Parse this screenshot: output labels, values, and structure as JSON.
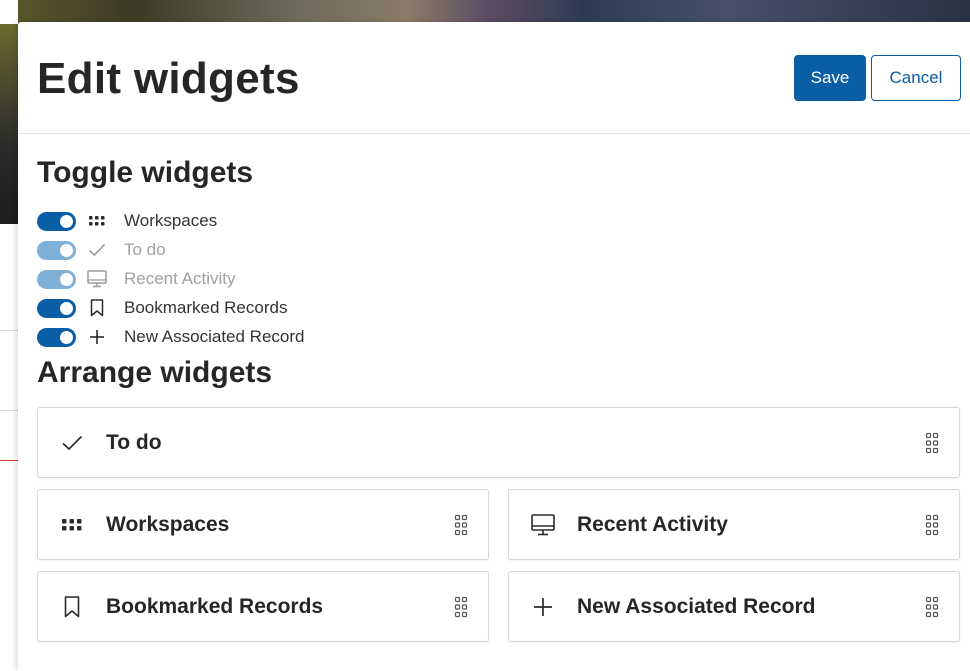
{
  "modal": {
    "title": "Edit widgets",
    "save_label": "Save",
    "cancel_label": "Cancel"
  },
  "toggle_section": {
    "title": "Toggle widgets",
    "items": [
      {
        "label": "Workspaces",
        "icon": "grid-dots-icon",
        "on": true,
        "disabled": false
      },
      {
        "label": "To do",
        "icon": "checkmark-icon",
        "on": true,
        "disabled": true
      },
      {
        "label": "Recent Activity",
        "icon": "monitor-icon",
        "on": true,
        "disabled": true
      },
      {
        "label": "Bookmarked Records",
        "icon": "bookmark-icon",
        "on": true,
        "disabled": false
      },
      {
        "label": "New Associated Record",
        "icon": "plus-icon",
        "on": true,
        "disabled": false
      }
    ]
  },
  "arrange_section": {
    "title": "Arrange widgets",
    "cards": [
      {
        "label": "To do",
        "icon": "checkmark-icon"
      },
      {
        "label": "Workspaces",
        "icon": "grid-dots-icon"
      },
      {
        "label": "Recent Activity",
        "icon": "monitor-icon"
      },
      {
        "label": "Bookmarked Records",
        "icon": "bookmark-icon"
      },
      {
        "label": "New Associated Record",
        "icon": "plus-icon"
      }
    ]
  },
  "colors": {
    "primary": "#0a5ea5",
    "toggle_disabled": "#7fb0d8",
    "border": "#d4d7db"
  }
}
